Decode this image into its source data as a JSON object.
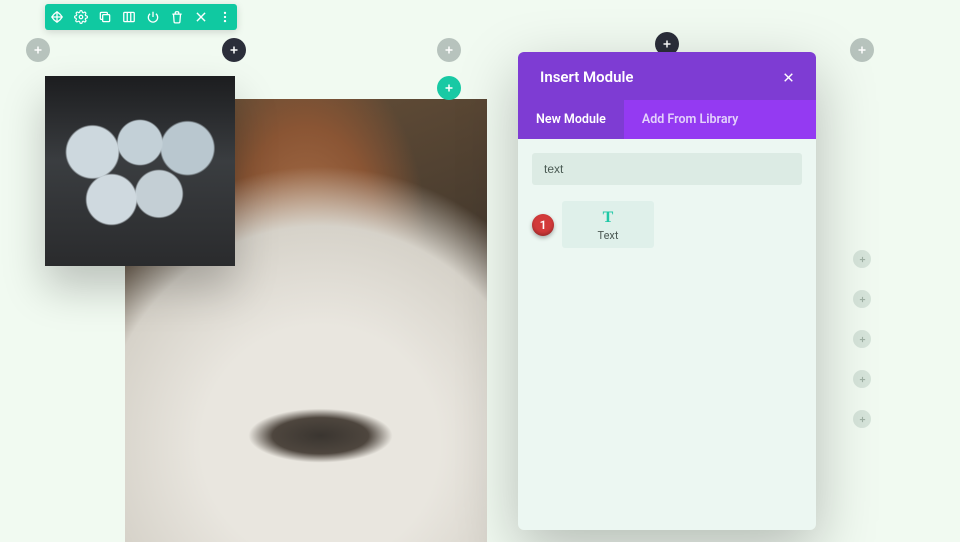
{
  "toolbar": {
    "icons": [
      "move-icon",
      "gear-icon",
      "duplicate-icon",
      "columns-icon",
      "power-icon",
      "trash-icon",
      "close-icon",
      "more-icon"
    ]
  },
  "modal": {
    "title": "Insert Module",
    "tabs": {
      "new": "New Module",
      "library": "Add From Library"
    },
    "search_value": "text",
    "callout": "1",
    "result": {
      "icon": "T",
      "label": "Text"
    }
  }
}
